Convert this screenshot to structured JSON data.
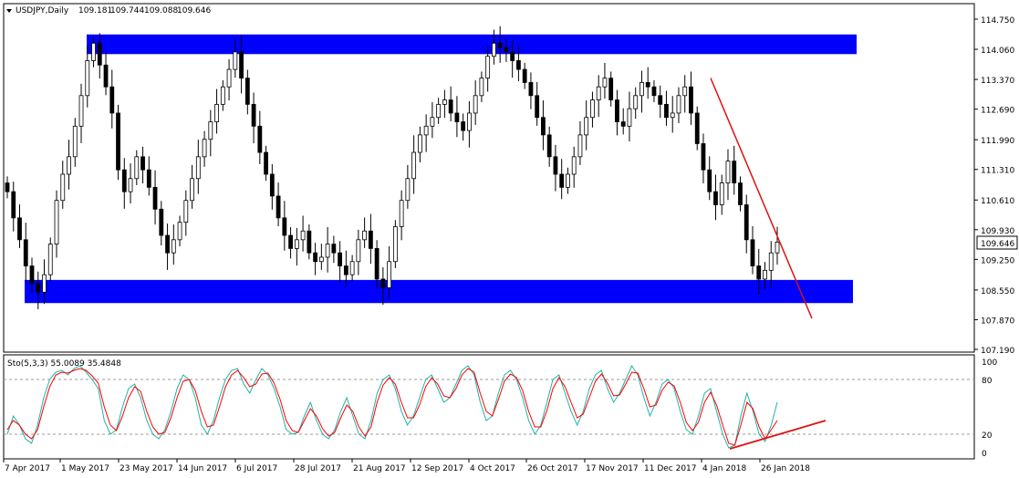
{
  "chart_data": [
    {
      "type": "candlestick",
      "title": "USDJPY,Daily",
      "ohlc_header": [
        "109.181",
        "109.744",
        "109.088",
        "109.646"
      ],
      "current_price_label": "109.646",
      "current_price": 109.646,
      "ylim": [
        107.19,
        114.75
      ],
      "y_ticks": [
        "114.750",
        "114.060",
        "113.370",
        "112.690",
        "111.990",
        "111.310",
        "110.610",
        "109.930",
        "109.250",
        "108.550",
        "107.870",
        "107.190"
      ],
      "y_tick_values": [
        114.75,
        114.06,
        113.37,
        112.69,
        111.99,
        111.31,
        110.61,
        109.93,
        109.25,
        108.55,
        107.87,
        107.19
      ],
      "x_tick_labels": [
        "7 Apr 2017",
        "1 May 2017",
        "23 May 2017",
        "14 Jun 2017",
        "6 Jul 2017",
        "28 Jul 2017",
        "21 Aug 2017",
        "12 Sep 2017",
        "4 Oct 2017",
        "26 Oct 2017",
        "17 Nov 2017",
        "11 Dec 2017",
        "4 Jan 2018",
        "26 Jan 2018"
      ],
      "close_series": [
        110.8,
        110.2,
        109.7,
        109.1,
        108.7,
        108.5,
        108.9,
        109.6,
        110.6,
        111.2,
        111.6,
        112.3,
        113.0,
        113.8,
        114.2,
        113.7,
        113.2,
        112.6,
        111.3,
        110.8,
        111.1,
        111.6,
        111.3,
        110.9,
        110.4,
        109.8,
        109.4,
        109.7,
        110.1,
        110.6,
        111.1,
        111.6,
        112.0,
        112.4,
        112.8,
        113.2,
        113.6,
        114.0,
        113.4,
        112.8,
        112.3,
        111.7,
        111.2,
        110.7,
        110.2,
        109.8,
        109.5,
        109.7,
        109.9,
        109.4,
        109.2,
        109.3,
        109.6,
        109.4,
        109.1,
        108.9,
        109.2,
        109.7,
        109.9,
        109.5,
        108.8,
        108.6,
        109.2,
        110.0,
        110.6,
        111.1,
        111.7,
        112.1,
        112.3,
        112.5,
        112.8,
        112.9,
        112.6,
        112.4,
        112.2,
        112.6,
        113.0,
        113.4,
        113.9,
        114.2,
        114.1,
        114.0,
        113.8,
        113.6,
        113.3,
        113.0,
        112.5,
        112.1,
        111.6,
        111.2,
        110.9,
        111.2,
        111.6,
        112.1,
        112.5,
        112.9,
        113.2,
        113.4,
        112.9,
        112.4,
        112.3,
        112.7,
        113.0,
        113.3,
        113.2,
        113.0,
        112.8,
        112.5,
        112.6,
        113.0,
        113.2,
        112.6,
        111.9,
        111.3,
        110.8,
        110.5,
        111.0,
        111.5,
        111.0,
        110.5,
        109.7,
        109.1,
        108.8,
        109.0,
        109.4,
        109.646
      ],
      "resistance_zone": [
        113.95,
        114.4
      ],
      "support_zone": [
        108.25,
        108.78
      ],
      "trendline": {
        "start": [
          "4 Jan 2018",
          113.4
        ],
        "end": [
          "after 26 Jan 2018",
          107.9
        ],
        "color": "#e01010"
      }
    },
    {
      "type": "line",
      "indicator_label": "Sto(5,3,3) 55.0089 35.4848",
      "ylim": [
        0,
        100
      ],
      "y_ticks": [
        "100",
        "80",
        "20",
        "0"
      ],
      "levels": [
        80,
        20
      ],
      "series": [
        {
          "name": "",
          "color": "#20b2aa",
          "values": [
            20,
            40,
            30,
            15,
            10,
            30,
            60,
            80,
            88,
            90,
            85,
            92,
            95,
            88,
            80,
            70,
            35,
            20,
            25,
            50,
            70,
            75,
            60,
            35,
            20,
            15,
            25,
            45,
            70,
            85,
            80,
            60,
            30,
            20,
            35,
            60,
            80,
            90,
            92,
            75,
            65,
            80,
            92,
            85,
            70,
            50,
            25,
            20,
            22,
            40,
            55,
            35,
            20,
            15,
            25,
            45,
            60,
            40,
            20,
            15,
            35,
            65,
            80,
            85,
            70,
            45,
            30,
            40,
            60,
            80,
            85,
            70,
            55,
            60,
            75,
            90,
            95,
            85,
            55,
            35,
            40,
            65,
            85,
            90,
            80,
            60,
            35,
            20,
            30,
            55,
            80,
            85,
            65,
            45,
            30,
            45,
            70,
            85,
            90,
            70,
            55,
            65,
            80,
            95,
            85,
            60,
            40,
            55,
            75,
            80,
            70,
            45,
            25,
            20,
            40,
            65,
            70,
            45,
            20,
            5,
            8,
            40,
            65,
            45,
            20,
            12,
            30,
            55
          ]
        },
        {
          "name": "",
          "color": "#ff0000",
          "values": [
            25,
            35,
            30,
            20,
            15,
            25,
            50,
            72,
            85,
            88,
            87,
            90,
            92,
            90,
            84,
            76,
            50,
            30,
            24,
            40,
            60,
            72,
            67,
            45,
            28,
            20,
            22,
            38,
            60,
            78,
            80,
            68,
            45,
            28,
            30,
            50,
            72,
            85,
            90,
            82,
            72,
            75,
            86,
            87,
            76,
            58,
            35,
            24,
            22,
            35,
            48,
            40,
            26,
            18,
            22,
            38,
            52,
            45,
            28,
            18,
            28,
            55,
            74,
            82,
            75,
            55,
            38,
            38,
            52,
            72,
            82,
            75,
            62,
            60,
            70,
            85,
            92,
            88,
            65,
            45,
            40,
            58,
            78,
            86,
            82,
            68,
            45,
            28,
            28,
            46,
            70,
            82,
            72,
            55,
            38,
            42,
            60,
            78,
            86,
            76,
            62,
            63,
            75,
            88,
            87,
            70,
            50,
            52,
            68,
            77,
            73,
            55,
            33,
            24,
            33,
            55,
            66,
            52,
            30,
            10,
            8,
            30,
            55,
            48,
            28,
            15,
            25,
            35
          ]
        }
      ]
    }
  ]
}
